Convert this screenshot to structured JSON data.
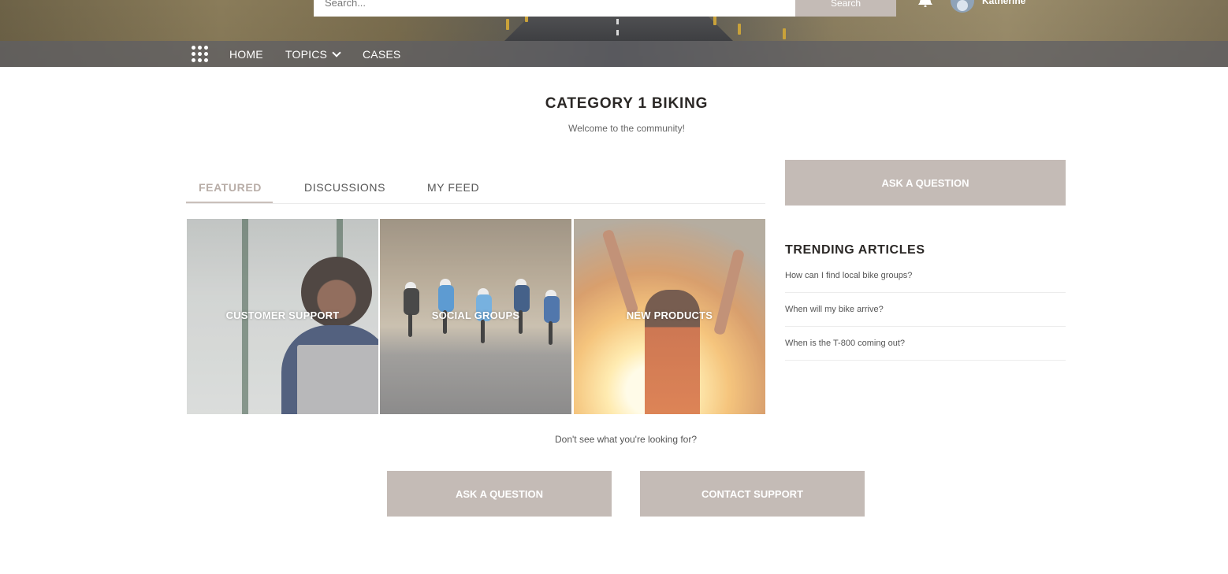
{
  "header": {
    "search_placeholder": "Search...",
    "search_button": "Search",
    "username": "Katherine"
  },
  "nav": {
    "items": [
      {
        "label": "HOME"
      },
      {
        "label": "TOPICS"
      },
      {
        "label": "CASES"
      }
    ]
  },
  "page": {
    "title": "CATEGORY 1 BIKING",
    "subtitle": "Welcome to the community!"
  },
  "tabs": [
    {
      "label": "FEATURED",
      "active": true
    },
    {
      "label": "DISCUSSIONS",
      "active": false
    },
    {
      "label": "MY FEED",
      "active": false
    }
  ],
  "tiles": [
    {
      "label": "CUSTOMER SUPPORT"
    },
    {
      "label": "SOCIAL GROUPS"
    },
    {
      "label": "NEW PRODUCTS"
    }
  ],
  "sidebar": {
    "ask_button": "ASK A QUESTION",
    "trending_title": "TRENDING ARTICLES",
    "articles": [
      {
        "title": "How can I find local bike groups?"
      },
      {
        "title": "When will my bike arrive?"
      },
      {
        "title": "When is the T-800 coming out?"
      }
    ]
  },
  "footer": {
    "prompt": "Don't see what you're looking for?",
    "ask_button": "ASK A QUESTION",
    "contact_button": "CONTACT SUPPORT"
  },
  "colors": {
    "button_bg": "#c4bbb6",
    "active_tab": "#b8ada7",
    "title_text": "#2b2826"
  }
}
